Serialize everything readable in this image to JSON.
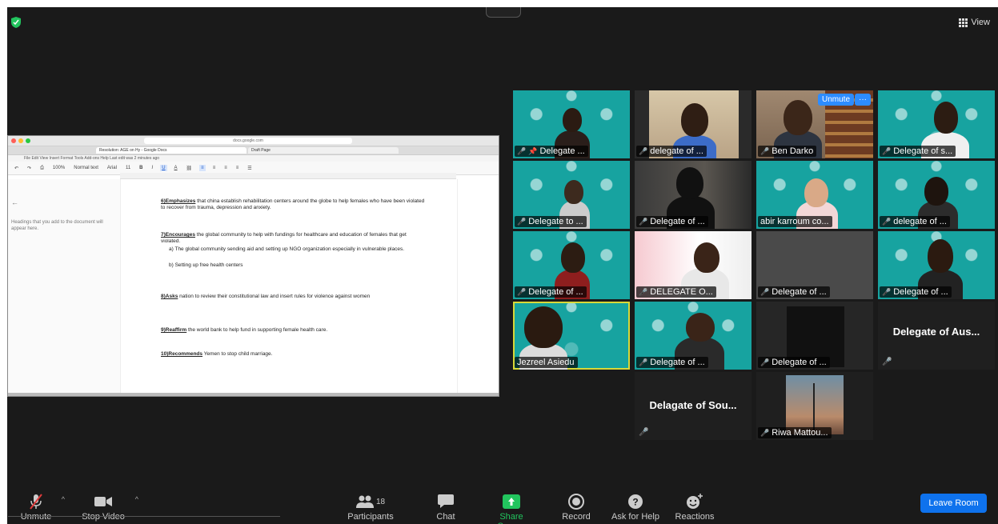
{
  "header": {
    "view_label": "View"
  },
  "shared_doc": {
    "url": "docs.google.com",
    "tab1": "Resolution: AGE on Hy - Google Docs",
    "tab2": "Draft Page",
    "menu": "File Edit View Insert Format Tools Add-ons Help Last edit was 2 minutes ago",
    "toolbar": [
      "100%",
      "Normal text",
      "Arial",
      "11",
      "B",
      "I",
      "U",
      "A"
    ],
    "sidebar_hint": "Headings that you add to the document will appear here.",
    "paragraphs": [
      {
        "lead": "6)Emphasizes",
        "text": " that china establish rehabilitation centers around the globe to help females who have been violated to recover from trauma, depression and anxiety."
      },
      {
        "lead": "7)Encourages",
        "text": " the global community to help with fundings for healthcare and education of females that get violated."
      },
      {
        "lead": "",
        "text": "a)  The global community sending aid and setting up NGO organization especially in vulnerable places."
      },
      {
        "lead": "",
        "text": "b)  Setting up free health centers"
      },
      {
        "lead": "8)Asks",
        "text": " nation to review their constitutional law and insert rules for violence against women"
      },
      {
        "lead": "9)Reaffirm",
        "text": " the world bank to help fund in supporting female health care."
      },
      {
        "lead": "10)Recommends",
        "text": " Yemen to stop child marriage."
      }
    ]
  },
  "participants": [
    {
      "name": "Delegate ...",
      "pinned": true
    },
    {
      "name": "delegate of ..."
    },
    {
      "name": "Ben Darko",
      "unmute_label": "Unmute",
      "more_label": "···"
    },
    {
      "name": "Delegate of s..."
    },
    {
      "name": "Delegate to ..."
    },
    {
      "name": "Delegate of ..."
    },
    {
      "name": "abir karroum co..."
    },
    {
      "name": "delegate of ..."
    },
    {
      "name": "Delegate of ..."
    },
    {
      "name": "DELEGATE O..."
    },
    {
      "name": "Delegate of ..."
    },
    {
      "name": "Delegate of ..."
    },
    {
      "name": "Jezreel Asiedu"
    },
    {
      "name": "Delegate of ..."
    },
    {
      "name": "Delegate of ..."
    },
    {
      "name": "Delegate of Aus..."
    },
    {
      "name": "Delagate of Sou..."
    },
    {
      "name": "Riwa Mattou..."
    }
  ],
  "controls": {
    "unmute": "Unmute",
    "stop_video": "Stop Video",
    "participants": "Participants",
    "participant_count": "18",
    "chat": "Chat",
    "share_screen": "Share Screen",
    "record": "Record",
    "ask_for_help": "Ask for Help",
    "reactions": "Reactions",
    "leave_room": "Leave Room"
  },
  "colors": {
    "share_green": "#22c55e",
    "leave_blue": "#0e72ed",
    "mic_off_red": "#e03b3b"
  }
}
